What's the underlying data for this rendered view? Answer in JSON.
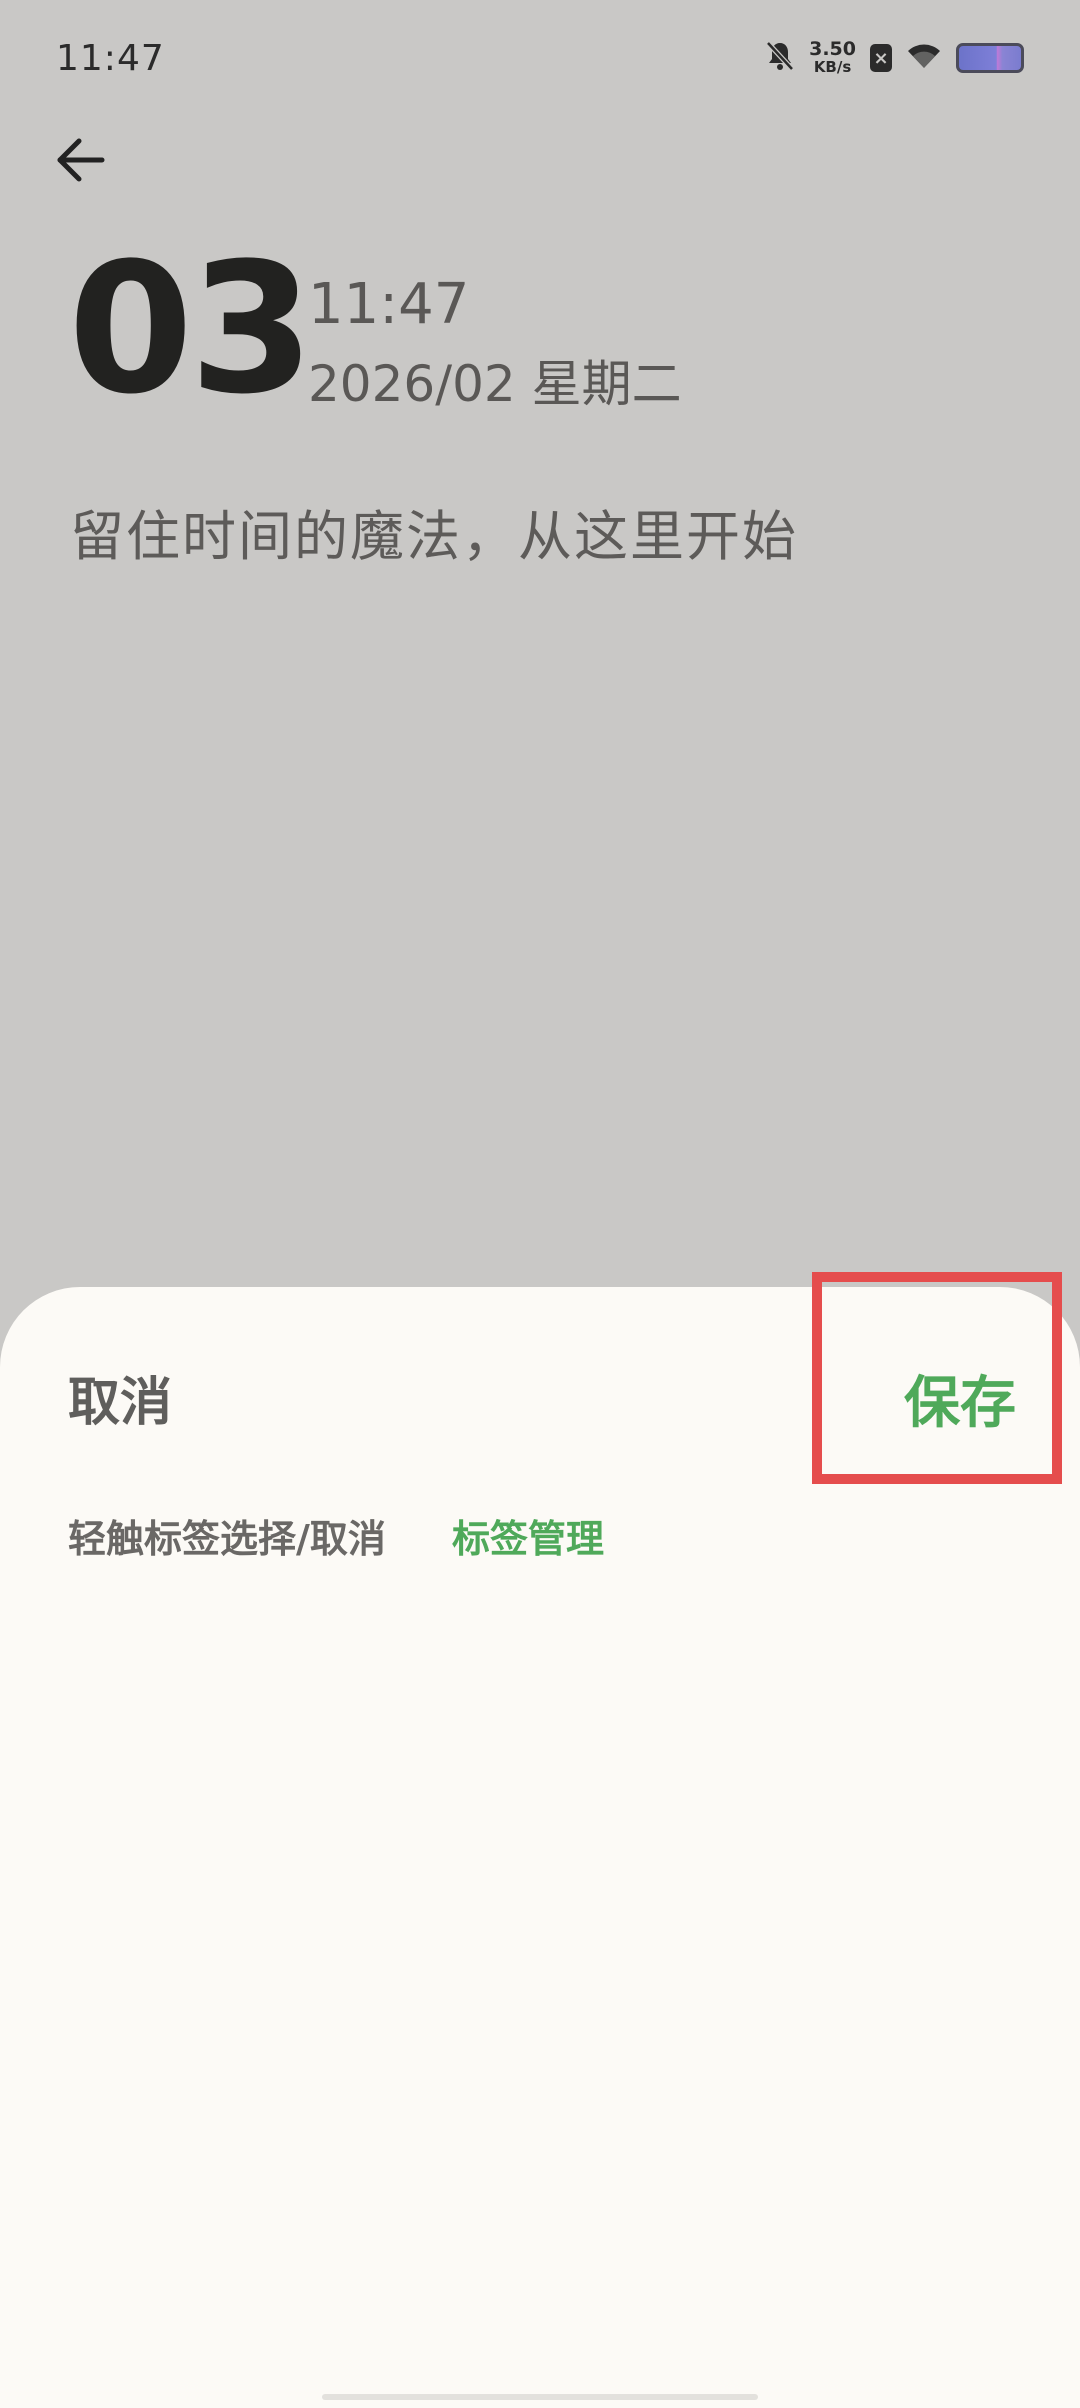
{
  "status_bar": {
    "time": "11:47",
    "net_speed_value": "3.50",
    "net_speed_unit": "KB/s",
    "sim_status": "×",
    "icons": [
      "bell-off-icon",
      "sim-x-icon",
      "wifi-icon",
      "battery-icon"
    ]
  },
  "header": {
    "day": "03",
    "time": "11:47",
    "date": "2026/02 星期二",
    "slogan": "留住时间的魔法，从这里开始"
  },
  "sheet": {
    "cancel_label": "取消",
    "save_label": "保存",
    "hint": "轻触标签选择/取消",
    "tag_manage_label": "标签管理"
  },
  "colors": {
    "background": "#c9c8c6",
    "sheet": "#fcfaf6",
    "accent_green": "#4fa95a",
    "highlight_red": "#e54d4d"
  }
}
